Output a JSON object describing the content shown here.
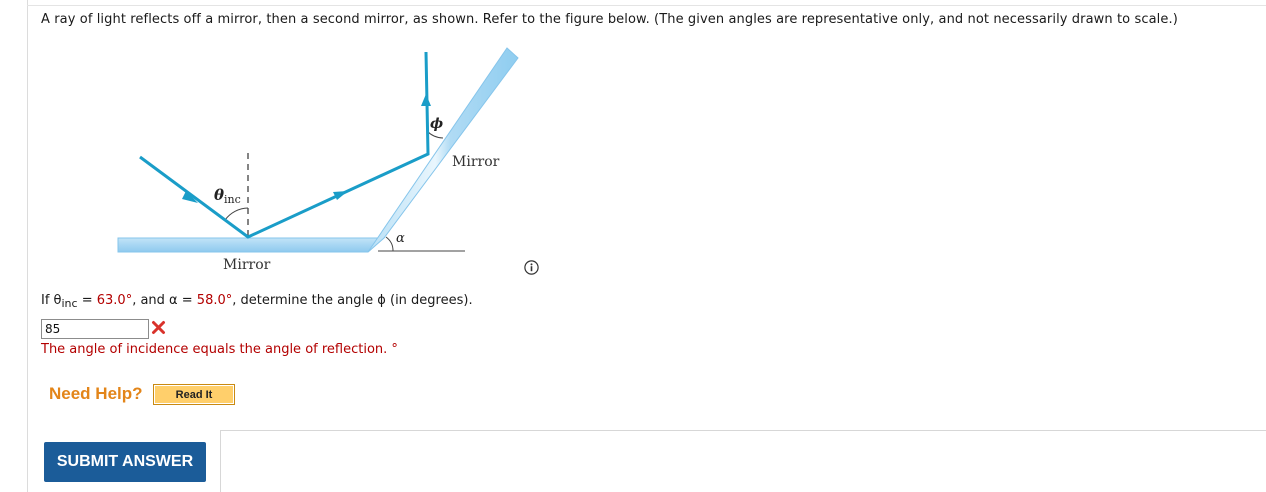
{
  "problem": {
    "statement": "A ray of light reflects off a mirror, then a second mirror, as shown. Refer to the figure below. (The given angles are representative only, and not necessarily drawn to scale.)"
  },
  "figure": {
    "theta_symbol": "θ",
    "theta_subscript": "inc",
    "alpha_symbol": "α",
    "phi_symbol": "ϕ",
    "mirror_label_bottom": "Mirror",
    "mirror_label_right": "Mirror",
    "colors": {
      "ray": "#1a9dc8",
      "mirror": "#a9d8f4",
      "mirror_edge": "#7ec1ea"
    }
  },
  "question": {
    "prefix": "If θ",
    "theta_sub": "inc",
    "eq1": " = ",
    "theta_value": "63.0°",
    "mid": ", and α = ",
    "alpha_value": "58.0°",
    "suffix": ", determine the angle ϕ (in degrees)."
  },
  "answer": {
    "value": "85",
    "status_icon": "x-mark-icon",
    "status_color": "#d9322b"
  },
  "feedback": {
    "text": "The angle of incidence equals the angle of reflection. °"
  },
  "help": {
    "label": "Need Help?",
    "read_it_label": "Read It"
  },
  "submit": {
    "label": "SUBMIT ANSWER"
  }
}
